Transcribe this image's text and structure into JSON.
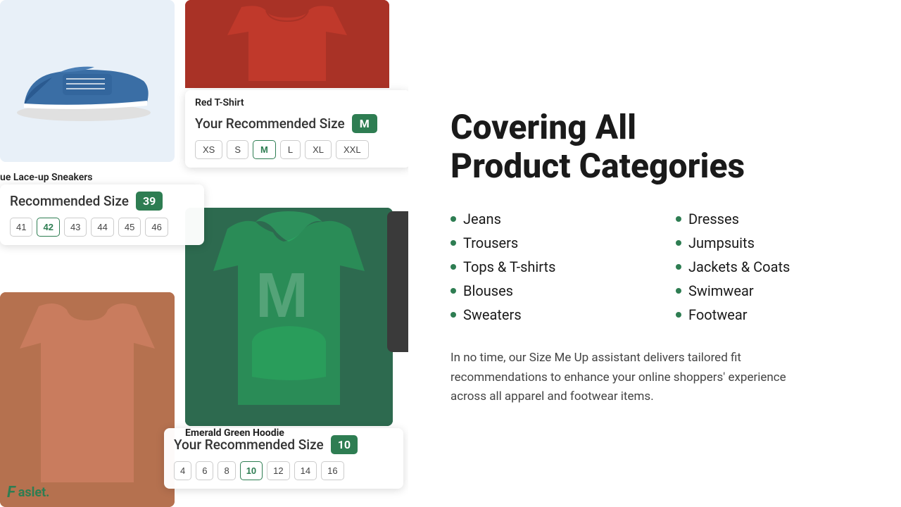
{
  "left": {
    "sneaker": {
      "label": "ue Lace-up Sneakers",
      "rec_label": "Recommended Size",
      "rec_size": "39",
      "sizes": [
        "41",
        "42",
        "43",
        "44",
        "45",
        "46"
      ]
    },
    "red_tshirt": {
      "label": "Red T-Shirt",
      "rec_label": "Your Recommended Size",
      "rec_size": "M",
      "sizes": [
        "XS",
        "S",
        "M",
        "L",
        "XL",
        "XXL"
      ],
      "active": "M"
    },
    "hoodie": {
      "label": "Emerald Green Hoodie",
      "rec_label": "Your Recommended Size",
      "rec_size": "10",
      "sizes": [
        "4",
        "6",
        "8",
        "10",
        "12",
        "14",
        "16"
      ],
      "active": "10",
      "letter": "M"
    }
  },
  "right": {
    "title_line1": "Covering All",
    "title_line2": "Product Categories",
    "categories_left": [
      "Jeans",
      "Trousers",
      "Tops & T-shirts",
      "Blouses",
      "Sweaters"
    ],
    "categories_right": [
      "Dresses",
      "Jumpsuits",
      "Jackets & Coats",
      "Swimwear",
      "Footwear"
    ],
    "description": "In no time, our Size Me Up assistant delivers tailored fit recommendations to enhance your online shoppers' experience across all apparel and footwear items."
  },
  "logo": {
    "text": "aslet."
  },
  "colors": {
    "green": "#2e7d52",
    "dark": "#3a3a3a"
  }
}
